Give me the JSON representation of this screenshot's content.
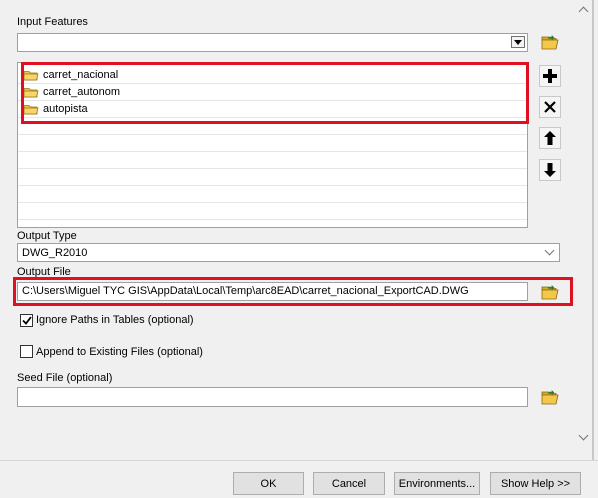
{
  "input_features": {
    "label": "Input Features",
    "value": "",
    "items": [
      {
        "name": "carret_nacional"
      },
      {
        "name": "carret_autonom"
      },
      {
        "name": "autopista"
      }
    ]
  },
  "output_type": {
    "label": "Output Type",
    "value": "DWG_R2010"
  },
  "output_file": {
    "label": "Output File",
    "value": "C:\\Users\\Miguel TYC GIS\\AppData\\Local\\Temp\\arc8EAD\\carret_nacional_ExportCAD.DWG"
  },
  "ignore_paths": {
    "label": "Ignore Paths in Tables (optional)",
    "checked": true
  },
  "append_existing": {
    "label": "Append to Existing Files (optional)",
    "checked": false
  },
  "seed_file": {
    "label": "Seed File (optional)",
    "value": ""
  },
  "footer": {
    "ok": "OK",
    "cancel": "Cancel",
    "environments": "Environments...",
    "show_help": "Show Help >>"
  },
  "icons": {
    "folder": "folder-open-icon",
    "feature_layer": "feature-layer-icon",
    "add": "plus-icon",
    "remove": "x-icon",
    "up": "arrow-up-icon",
    "down": "arrow-down-icon"
  },
  "colors": {
    "highlight": "#e01020",
    "background": "#f0f0f0"
  }
}
